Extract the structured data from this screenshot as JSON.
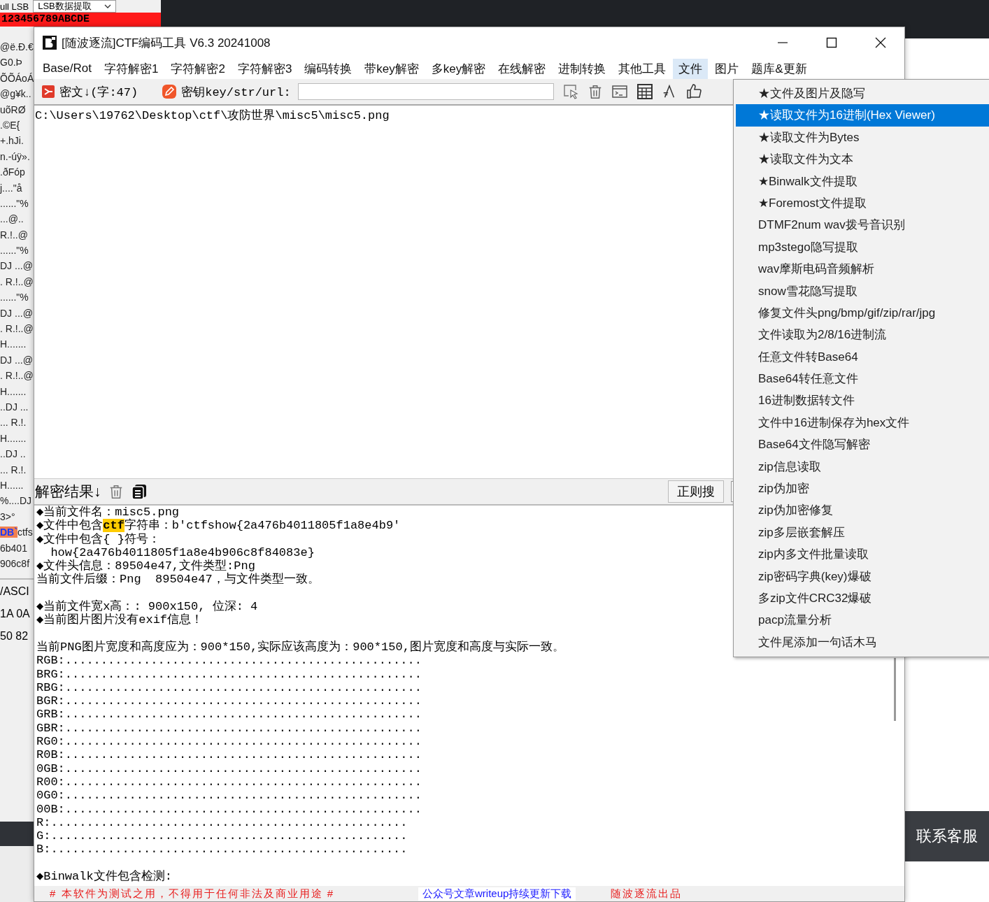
{
  "background_window": {
    "top_label": "ull LSB",
    "dropdown_value": "LSB数据提取",
    "red_bar": "123456789ABCDE",
    "lines": [
      {
        "text": "@ë.Ð.€"
      },
      {
        "text": "G0.Þ"
      },
      {
        "text": "ÕÕÁoÁ"
      },
      {
        "text": "@g¥k.."
      },
      {
        "text": "uõRØ"
      },
      {
        "text": ".©E{"
      },
      {
        "text": "+.hJi."
      },
      {
        "text": "n.-úÿ»."
      },
      {
        "text": ".ðFóp"
      },
      {
        "text": "j....\"å"
      },
      {
        "text": "......\"%"
      },
      {
        "text": "...@.."
      },
      {
        "text": "R.!..@"
      },
      {
        "text": "......\"%"
      },
      {
        "text": "DJ ...@"
      },
      {
        "text": ". R.!..@"
      },
      {
        "text": "......\"%"
      },
      {
        "text": "DJ ...@"
      },
      {
        "text": ". R.!..@"
      },
      {
        "text": "H......."
      },
      {
        "text": "DJ ...@"
      },
      {
        "text": ". R.!..@"
      },
      {
        "text": "H......."
      },
      {
        "text": "..DJ ..."
      },
      {
        "text": "... R.!."
      },
      {
        "text": "H......."
      },
      {
        "text": "..DJ .."
      },
      {
        "text": "... R.!."
      },
      {
        "text": "H......"
      },
      {
        "text": "%....DJ"
      },
      {
        "text": "3>°"
      },
      {
        "highlight": "DB`",
        "text": "ctfs"
      },
      {
        "text": "6b401"
      },
      {
        "text": "906c8f"
      }
    ],
    "lower_lines": [
      "/ASCI",
      "1A 0A",
      "50 82"
    ]
  },
  "side_panel": {
    "text": "联系客服"
  },
  "window": {
    "title": "[随波逐流]CTF编码工具 V6.3 20241008",
    "menu": [
      {
        "label": "Base/Rot",
        "selected": false
      },
      {
        "label": "字符解密1",
        "selected": false
      },
      {
        "label": "字符解密2",
        "selected": false
      },
      {
        "label": "字符解密3",
        "selected": false
      },
      {
        "label": "编码转换",
        "selected": false
      },
      {
        "label": "带key解密",
        "selected": false
      },
      {
        "label": "多key解密",
        "selected": false
      },
      {
        "label": "在线解密",
        "selected": false
      },
      {
        "label": "进制转换",
        "selected": false
      },
      {
        "label": "其他工具",
        "selected": false
      },
      {
        "label": "文件",
        "selected": true
      },
      {
        "label": "图片",
        "selected": false
      },
      {
        "label": "题库&更新",
        "selected": false
      }
    ],
    "toolbar": {
      "ciphertext_label": "密文↓(字:47)",
      "key_label": "密钥key/str/url:"
    },
    "input_text": "C:\\Users\\19762\\Desktop\\ctf\\攻防世界\\misc5\\misc5.png",
    "result_bar": {
      "label": "解密结果↓",
      "regex_button": "正则搜"
    },
    "result_blocks": [
      {
        "lines": [
          {
            "text": "◆当前文件名：misc5.png"
          },
          {
            "segments": [
              {
                "text": "◆文件中包含",
                "highlighted": false
              },
              {
                "text": "ctf",
                "highlighted": true
              },
              {
                "text": "字符串：b'ctfshow{2a476b4011805f1a8e4b9'",
                "highlighted": false
              }
            ]
          },
          {
            "text": "◆文件中包含{ }符号："
          },
          {
            "text": "  how{2a476b4011805f1a8e4b906c8f84083e}"
          },
          {
            "text": "◆文件头信息：89504e47,文件类型:Png"
          },
          {
            "text": "当前文件后缀：Png  89504e47，与文件类型一致。"
          }
        ]
      },
      {
        "lines": [
          {
            "text": "◆当前文件宽x高：: 900x150, 位深: 4"
          },
          {
            "text": "◆当前图片图片没有exif信息！"
          }
        ]
      },
      {
        "lines": [
          {
            "text": "当前PNG图片宽度和高度应为：900*150,实际应该高度为：900*150,图片宽度和高度与实际一致。"
          },
          {
            "text": "RGB:.................................................."
          },
          {
            "text": "BRG:.................................................."
          },
          {
            "text": "RBG:.................................................."
          },
          {
            "text": "BGR:.................................................."
          },
          {
            "text": "GRB:.................................................."
          },
          {
            "text": "GBR:.................................................."
          },
          {
            "text": "RG0:.................................................."
          },
          {
            "text": "R0B:.................................................."
          },
          {
            "text": "0GB:.................................................."
          },
          {
            "text": "R00:.................................................."
          },
          {
            "text": "0G0:.................................................."
          },
          {
            "text": "00B:.................................................."
          },
          {
            "text": "R:.................................................."
          },
          {
            "text": "G:.................................................."
          },
          {
            "text": "B:.................................................."
          }
        ]
      },
      {
        "lines": [
          {
            "text": "◆Binwalk文件包含检测:"
          }
        ]
      }
    ],
    "dropdown": [
      {
        "label": "★文件及图片及隐写",
        "selected": false
      },
      {
        "label": "★读取文件为16进制(Hex Viewer)",
        "selected": true
      },
      {
        "label": "★读取文件为Bytes",
        "selected": false
      },
      {
        "label": "★读取文件为文本",
        "selected": false
      },
      {
        "label": "★Binwalk文件提取",
        "selected": false
      },
      {
        "label": "★Foremost文件提取",
        "selected": false
      },
      {
        "label": "DTMF2num  wav拨号音识别",
        "selected": false
      },
      {
        "label": "mp3stego隐写提取",
        "selected": false
      },
      {
        "label": "wav摩斯电码音频解析",
        "selected": false
      },
      {
        "label": "snow雪花隐写提取",
        "selected": false
      },
      {
        "label": "修复文件头png/bmp/gif/zip/rar/jpg",
        "selected": false
      },
      {
        "label": "文件读取为2/8/16进制流",
        "selected": false
      },
      {
        "label": "任意文件转Base64",
        "selected": false
      },
      {
        "label": "Base64转任意文件",
        "selected": false
      },
      {
        "label": "16进制数据转文件",
        "selected": false
      },
      {
        "label": "文件中16进制保存为hex文件",
        "selected": false
      },
      {
        "label": "Base64文件隐写解密",
        "selected": false
      },
      {
        "label": "zip信息读取",
        "selected": false
      },
      {
        "label": "zip伪加密",
        "selected": false
      },
      {
        "label": "zip伪加密修复",
        "selected": false
      },
      {
        "label": "zip多层嵌套解压",
        "selected": false
      },
      {
        "label": "zip内多文件批量读取",
        "selected": false
      },
      {
        "label": "zip密码字典(key)爆破",
        "selected": false
      },
      {
        "label": "多zip文件CRC32爆破",
        "selected": false
      },
      {
        "label": "pacp流量分析",
        "selected": false
      },
      {
        "label": "文件尾添加一句话木马",
        "selected": false
      }
    ],
    "status_bar": [
      {
        "text": "# 本软件为测试之用，不得用于任何非法及商业用途 #",
        "kind": "notice"
      },
      {
        "text": "公众号文章writeup持续更新下载",
        "kind": "link"
      },
      {
        "text": "随波逐流出品",
        "kind": "notice"
      }
    ]
  }
}
